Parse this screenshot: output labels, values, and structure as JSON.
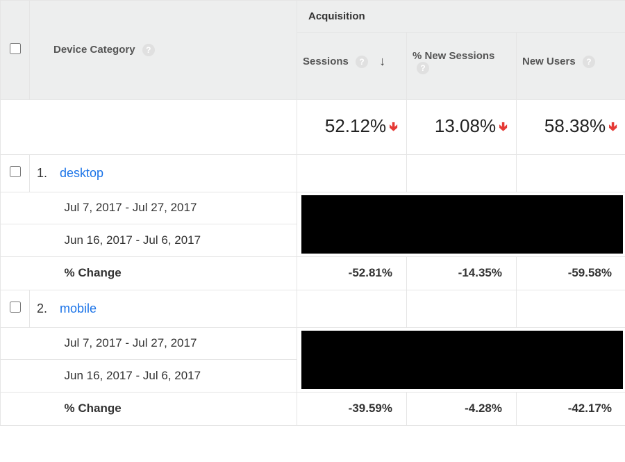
{
  "header": {
    "device_label": "Device Category",
    "group_label": "Acquisition",
    "metrics": {
      "sessions": "Sessions",
      "pct_new_sessions": "% New Sessions",
      "new_users": "New Users"
    }
  },
  "summary": {
    "sessions": "52.12%",
    "pct_new_sessions": "13.08%",
    "new_users": "58.38%"
  },
  "rows": [
    {
      "index": "1.",
      "name": "desktop",
      "period_a": "Jul 7, 2017 - Jul 27, 2017",
      "period_b": "Jun 16, 2017 - Jul 6, 2017",
      "change_label": "% Change",
      "change": {
        "sessions": "-52.81%",
        "pct_new_sessions": "-14.35%",
        "new_users": "-59.58%"
      }
    },
    {
      "index": "2.",
      "name": "mobile",
      "period_a": "Jul 7, 2017 - Jul 27, 2017",
      "period_b": "Jun 16, 2017 - Jul 6, 2017",
      "change_label": "% Change",
      "change": {
        "sessions": "-39.59%",
        "pct_new_sessions": "-4.28%",
        "new_users": "-42.17%"
      }
    }
  ]
}
